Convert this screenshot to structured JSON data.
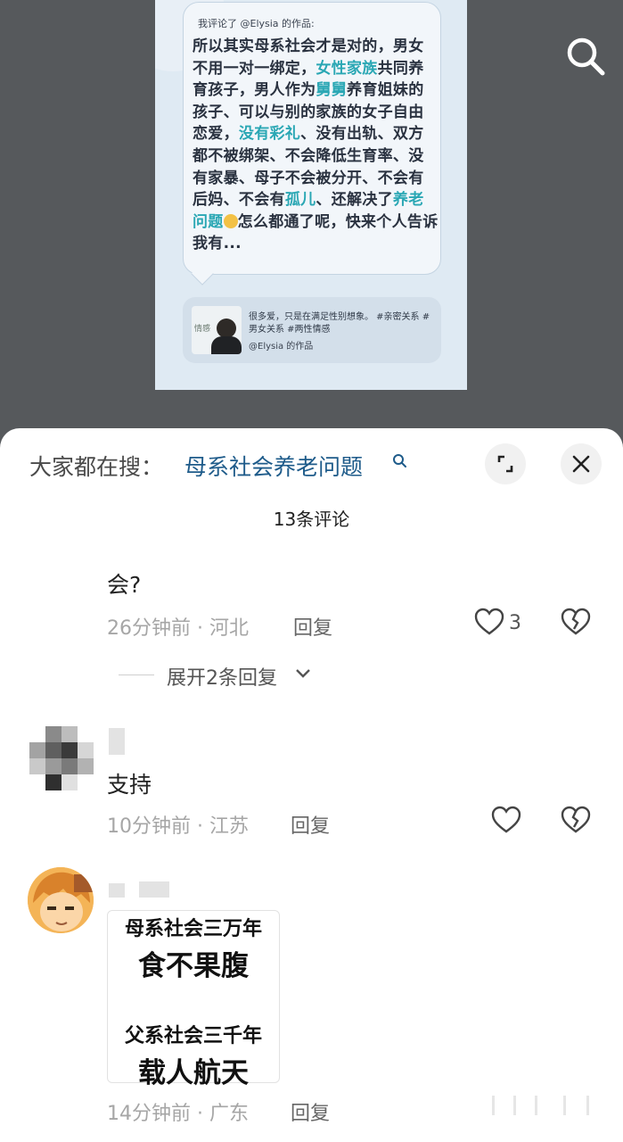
{
  "preview": {
    "header": "我评论了 @Elysia 的作品:",
    "text_parts": [
      {
        "t": "所以其实母系社会才是对的，男女不用一对一绑定，",
        "hl": false
      },
      {
        "t": "女性家族",
        "hl": true
      },
      {
        "t": "共同养育孩子，男人作为",
        "hl": false
      },
      {
        "t": "舅舅",
        "hl": true
      },
      {
        "t": "养育姐妹的孩子、可以与别的家族的女子自由恋爱，",
        "hl": false
      },
      {
        "t": "没有彩礼",
        "hl": true
      },
      {
        "t": "、没有出轨、双方都不被绑架、不会降低生育率、没有家暴、母子不会被分开、不会有后妈、不会有",
        "hl": false
      },
      {
        "t": "孤儿",
        "hl": true
      },
      {
        "t": "、还解决了",
        "hl": false
      },
      {
        "t": "养老问题",
        "hl": true
      }
    ],
    "text_tail": "怎么都通了呢，快来个人告诉我有...",
    "source_text": "很多爱，只是在满足性别想象。 #亲密关系 #男女关系 #两性情感",
    "source_author": "@Elysia 的作品",
    "thumb_text": "情感"
  },
  "sheet": {
    "hot_label": "大家都在搜：",
    "hot_query": "母系社会养老问题",
    "comment_count": "13条评论",
    "comments": [
      {
        "text": "会?",
        "meta": "26分钟前 · 河北",
        "reply": "回复",
        "likes": "3",
        "expand": "展开2条回复"
      },
      {
        "text": "支持",
        "meta": "10分钟前 · 江苏",
        "reply": "回复"
      },
      {
        "meme": [
          "母系社会三万年",
          "食不果腹",
          "父系社会三千年",
          "载人航天"
        ],
        "meta": "14分钟前 · 广东",
        "reply": "回复"
      }
    ]
  },
  "colors": {
    "highlight": "#2aa7b4",
    "query": "#1e5b8a",
    "backdrop": "#56595c"
  }
}
